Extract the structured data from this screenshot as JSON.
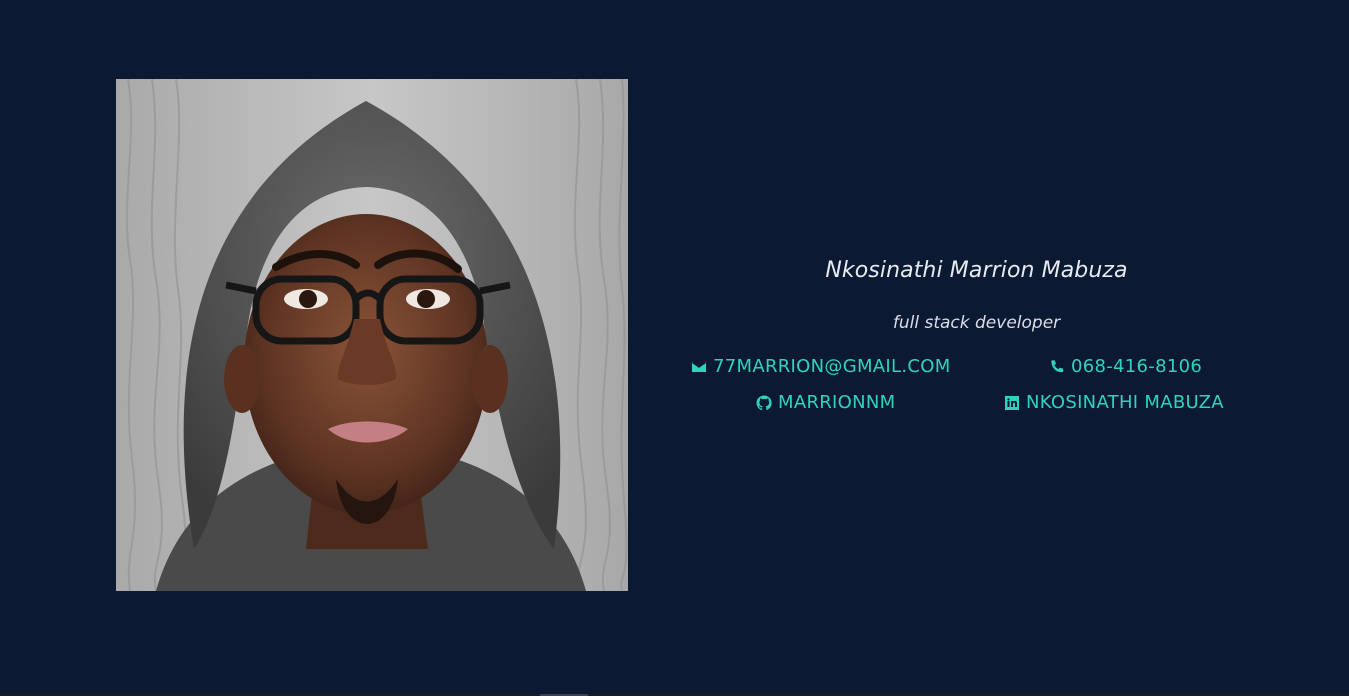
{
  "profile": {
    "name": "Nkosinathi Marrion Mabuza",
    "role": "full stack developer"
  },
  "contacts": {
    "email": "77MARRION@GMAIL.COM",
    "phone": "068-416-8106",
    "github": "MARRIONNM",
    "linkedin": "NKOSINATHI MABUZA"
  },
  "icons": {
    "email": "envelope-icon",
    "phone": "phone-icon",
    "github": "github-icon",
    "linkedin": "linkedin-icon"
  },
  "colors": {
    "background": "#0b1a32",
    "accent": "#2ed3c0",
    "text": "#e6ebf2"
  }
}
